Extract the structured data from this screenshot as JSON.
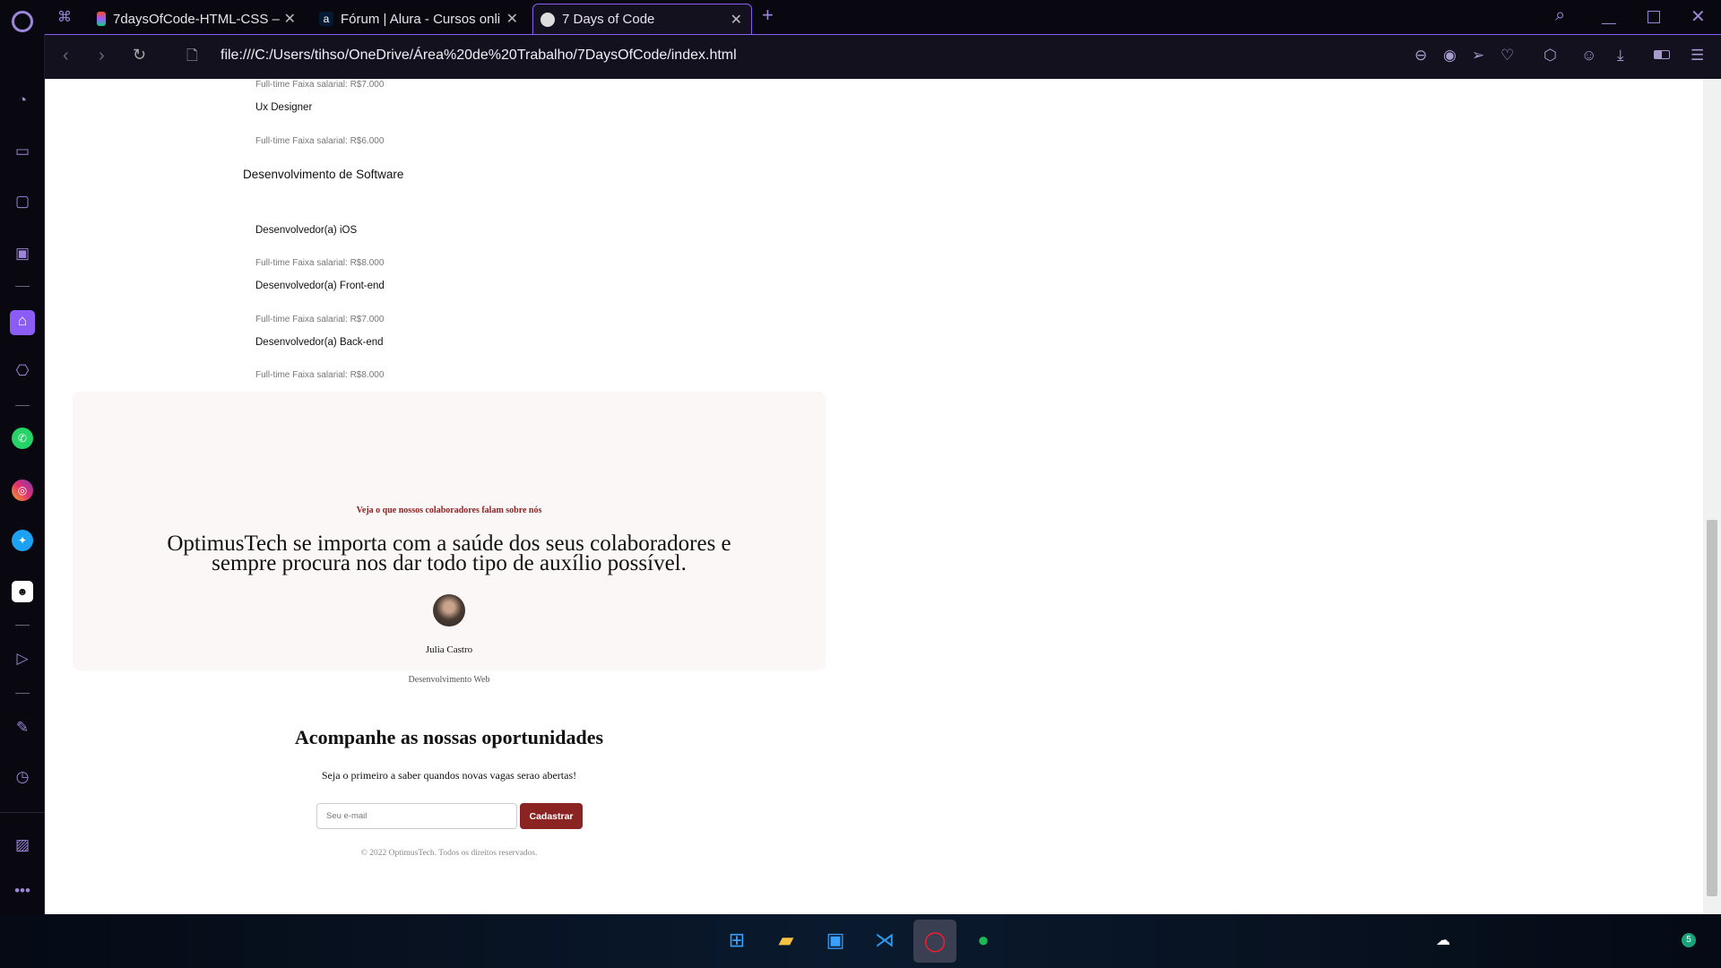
{
  "browser": {
    "tabs": [
      {
        "title": "7daysOfCode-HTML-CSS –",
        "icon": "figma-icon"
      },
      {
        "title": "Fórum | Alura - Cursos onli",
        "icon": "alura-icon"
      },
      {
        "title": "7 Days of Code",
        "icon": "globe-icon",
        "active": true
      }
    ],
    "url": "file:///C:/Users/tihso/OneDrive/Área%20de%20Trabalho/7DaysOfCode/index.html",
    "accent": "#8b5cf6"
  },
  "jobs": {
    "top_salary": "Full-time Faixa salarial: R$7.000",
    "ux": {
      "title": "Ux Designer",
      "salary": "Full-time Faixa salarial: R$6.000"
    },
    "category": "Desenvolvimento de Software",
    "items": [
      {
        "title": "Desenvolvedor(a) iOS",
        "salary": "Full-time Faixa salarial: R$8.000"
      },
      {
        "title": "Desenvolvedor(a) Front-end",
        "salary": "Full-time Faixa salarial: R$7.000"
      },
      {
        "title": "Desenvolvedor(a) Back-end",
        "salary": "Full-time Faixa salarial: R$8.000"
      }
    ]
  },
  "testimonial": {
    "label": "Veja o que nossos colaboradores falam sobre nós",
    "quote_line1": "OptimusTech se importa com a saúde dos seus colaboradores e",
    "quote_line2": "sempre procura nos dar todo tipo de auxílio possível.",
    "name": "Julia Castro",
    "role": "Desenvolvimento Web"
  },
  "newsletter": {
    "title": "Acompanhe as nossas oportunidades",
    "subtitle": "Seja o primeiro a saber quandos novas vagas serao abertas!",
    "email_placeholder": "Seu e-mail",
    "button": "Cadastrar",
    "button_color": "#8b2323"
  },
  "footer": "© 2022 OptimusTech. Todos os direitos reservados.",
  "taskbar": {
    "badge": "5"
  }
}
